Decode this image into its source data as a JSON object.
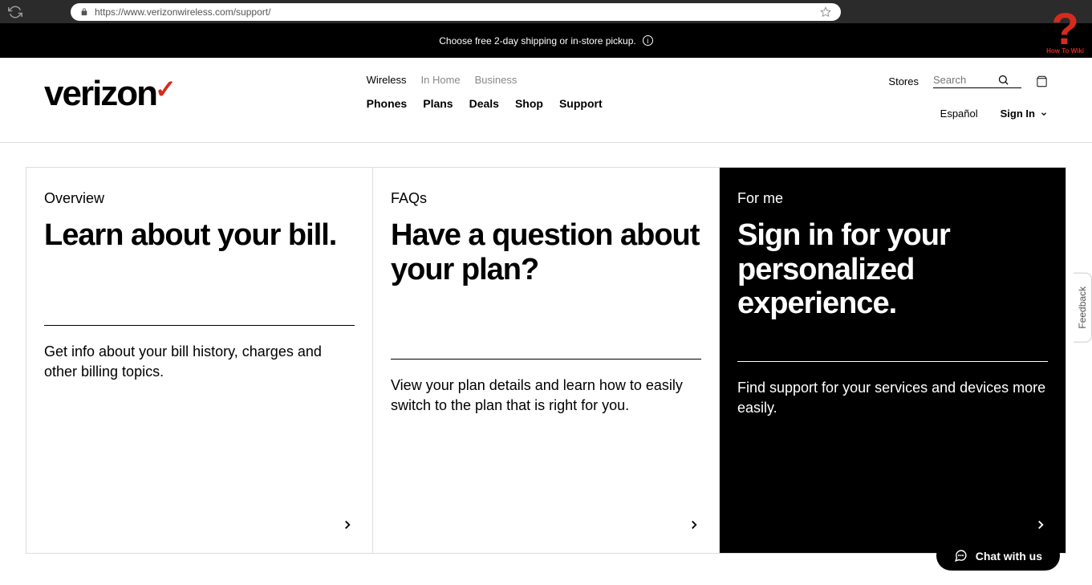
{
  "browser": {
    "url": "https://www.verizonwireless.com/support/"
  },
  "top_banner": {
    "text": "Choose free 2-day shipping or in-store pickup."
  },
  "header": {
    "logo": "verizon",
    "tabs": [
      "Wireless",
      "In Home",
      "Business"
    ],
    "nav": [
      "Phones",
      "Plans",
      "Deals",
      "Shop",
      "Support"
    ],
    "stores": "Stores",
    "search_placeholder": "Search",
    "espanol": "Español",
    "signin": "Sign In"
  },
  "cards": [
    {
      "eyebrow": "Overview",
      "title": "Learn about your bill.",
      "desc": "Get info about your bill history, charges and other billing topics."
    },
    {
      "eyebrow": "FAQs",
      "title": "Have a question about your plan?",
      "desc": "View your plan details and learn how to easily switch to the plan that is right for you."
    },
    {
      "eyebrow": "For me",
      "title": "Sign in for your personalized experience.",
      "desc": "Find support for your services and devices more easily."
    }
  ],
  "chat": {
    "label": "Chat with us"
  },
  "feedback": "Feedback",
  "howto": {
    "label": "How To Wiki"
  }
}
